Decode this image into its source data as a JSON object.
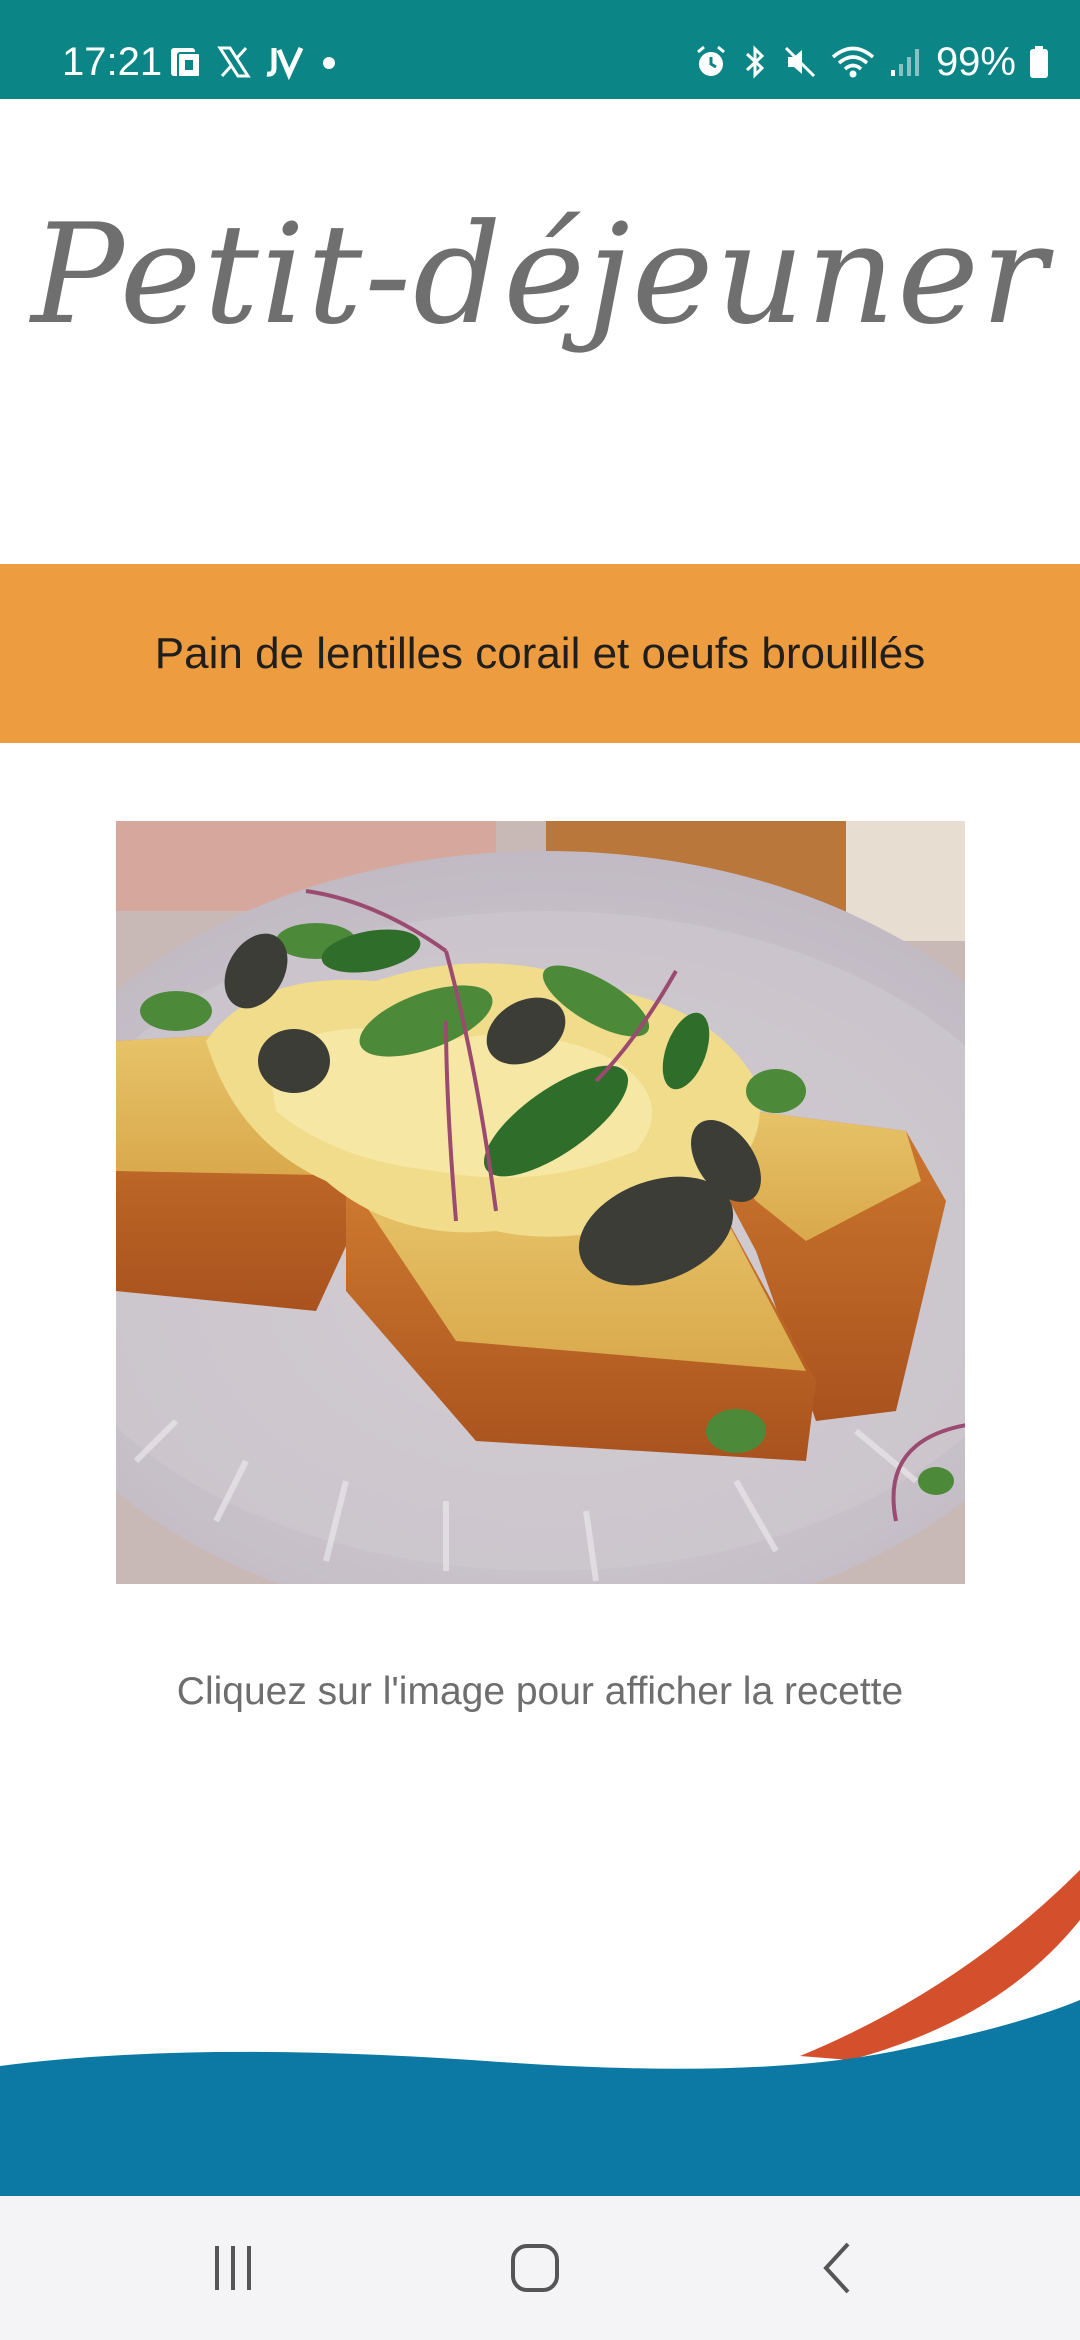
{
  "status_bar": {
    "time": "17:21",
    "left_icons": [
      "sim-card-icon",
      "x-icon",
      "jv-icon",
      "dot-icon"
    ],
    "right_icons": [
      "alarm-icon",
      "bluetooth-icon",
      "mute-icon",
      "wifi-icon",
      "signal-icon",
      "battery-icon"
    ],
    "battery_percent": "99%",
    "background_color": "#0b8585"
  },
  "page": {
    "title": "Petit-déjeuner",
    "recipe_title": "Pain de lentilles corail et oeufs brouillés",
    "hint": "Cliquez sur l'image pour afficher la recette",
    "banner_color": "#ed9c3f"
  },
  "decoration": {
    "wave_blue_color": "#0b79a3",
    "wave_red_color": "#d4502c"
  },
  "nav_bar": {
    "buttons": [
      "recent-apps-icon",
      "home-icon",
      "back-icon"
    ]
  }
}
